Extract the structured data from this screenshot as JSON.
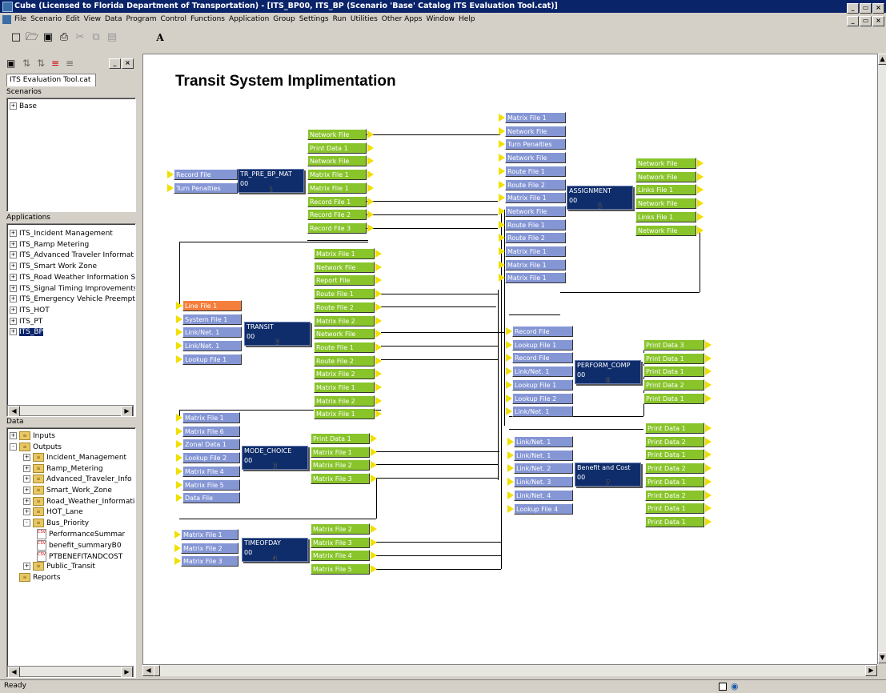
{
  "window": {
    "title": "Cube (Licensed to Florida Department of Transportation) - [ITS_BP00, ITS_BP (Scenario 'Base' Catalog ITS Evaluation Tool.cat)]"
  },
  "menu": [
    "File",
    "Scenario",
    "Edit",
    "View",
    "Data",
    "Program",
    "Control",
    "Functions",
    "Application",
    "Group",
    "Settings",
    "Run",
    "Utilities",
    "Other Apps",
    "Window",
    "Help"
  ],
  "toolbar_text_tool": "A",
  "panel": {
    "tab": "ITS Evaluation Tool.cat",
    "scenarios_title": "Scenarios",
    "scenarios": [
      "Base"
    ],
    "applications_title": "Applications",
    "applications": [
      "ITS_Incident Management",
      "ITS_Ramp Metering",
      "ITS_Advanced Traveler Informat",
      "ITS_Smart Work Zone",
      "ITS_Road Weather Information S",
      "ITS_Signal Timing Improvements",
      "ITS_Emergency Vehicle Preempt",
      "ITS_HOT",
      "ITS_PT",
      "ITS_BP"
    ],
    "data_title": "Data",
    "data": [
      {
        "label": "Inputs",
        "level": 0,
        "pm": "+",
        "kind": "folder"
      },
      {
        "label": "Outputs",
        "level": 0,
        "pm": "-",
        "kind": "folder"
      },
      {
        "label": "Incident_Management",
        "level": 1,
        "pm": "+",
        "kind": "folder"
      },
      {
        "label": "Ramp_Metering",
        "level": 1,
        "pm": "+",
        "kind": "folder"
      },
      {
        "label": "Advanced_Traveler_Info",
        "level": 1,
        "pm": "+",
        "kind": "folder"
      },
      {
        "label": "Smart_Work_Zone",
        "level": 1,
        "pm": "+",
        "kind": "folder"
      },
      {
        "label": "Road_Weather_Informati",
        "level": 1,
        "pm": "+",
        "kind": "folder"
      },
      {
        "label": "HOT_Lane",
        "level": 1,
        "pm": "+",
        "kind": "folder"
      },
      {
        "label": "Bus_Priority",
        "level": 1,
        "pm": "-",
        "kind": "folder"
      },
      {
        "label": "PerformanceSummar",
        "level": 2,
        "pm": "",
        "kind": "file"
      },
      {
        "label": "benefit_summaryB0",
        "level": 2,
        "pm": "",
        "kind": "file"
      },
      {
        "label": "PTBENEFITANDCOST",
        "level": 2,
        "pm": "",
        "kind": "file"
      },
      {
        "label": "Public_Transit",
        "level": 1,
        "pm": "+",
        "kind": "folder"
      },
      {
        "label": "Reports",
        "level": 0,
        "pm": "",
        "kind": "folder"
      }
    ]
  },
  "canvas": {
    "title": "Transit System Implimentation",
    "programs": [
      {
        "name": "TR_PRE_BP_MAT",
        "code": "00",
        "num": "1"
      },
      {
        "name": "TRANSIT",
        "code": "00",
        "num": "2"
      },
      {
        "name": "MODE_CHOICE",
        "code": "00",
        "num": "3"
      },
      {
        "name": "TIMEOFDAY",
        "code": "00",
        "num": "4"
      },
      {
        "name": "ASSIGNMENT",
        "code": "00",
        "num": "5"
      },
      {
        "name": "PERFORM_COMP",
        "code": "00",
        "num": "6"
      },
      {
        "name": "Benefit and Cost",
        "code": "00",
        "num": "7"
      }
    ],
    "p1_in": [
      "Record File",
      "Turn Penalties"
    ],
    "p1_out": [
      "Network File",
      "Print Data 1",
      "Network File",
      "Matrix File 1",
      "Matrix File 1",
      "Record File 1",
      "Record File 2",
      "Record File 3"
    ],
    "p2_in": [
      "Line File 1",
      "System File 1",
      "Link/Net. 1",
      "Link/Net. 1",
      "Lookup File 1"
    ],
    "p2_out": [
      "Matrix File 1",
      "Network File",
      "Report File",
      "Route File 1",
      "Route File 2",
      "Matrix File 2",
      "Network File",
      "Route File 1",
      "Route File 2",
      "Matrix File 2",
      "Matrix File 1",
      "Matrix File 2",
      "Matrix File 1"
    ],
    "p3_in": [
      "Matrix File 1",
      "Matrix File 6",
      "Zonal Data 1",
      "Lookup File 2",
      "Matrix File 4",
      "Matrix File 5",
      "Data File"
    ],
    "p3_out": [
      "Print Data 1",
      "Matrix File 1",
      "Matrix File 2",
      "Matrix File 3"
    ],
    "p4_in": [
      "Matrix File 1",
      "Matrix File 2",
      "Matrix File 3"
    ],
    "p4_out": [
      "Matrix File 2",
      "Matrix File 3",
      "Matrix File 4",
      "Matrix File 5"
    ],
    "p5_in": [
      "Matrix File 1",
      "Network File",
      "Turn Penalties",
      "Network File",
      "Route File 1",
      "Route File 2",
      "Matrix File 1",
      "Network File",
      "Route File 1",
      "Route File 2",
      "Matrix File 1",
      "Matrix File 1",
      "Matrix File 1"
    ],
    "p5_out": [
      "Network File",
      "Network File",
      "Links File 1",
      "Network File",
      "Links File 1",
      "Network File"
    ],
    "p6_in": [
      "Record File",
      "Lookup File 1",
      "Record File",
      "Link/Net. 1",
      "Lookup File 1",
      "Lookup File 2",
      "Link/Net. 1"
    ],
    "p6_out": [
      "Print Data 3",
      "Print Data 1",
      "Print Data 1",
      "Print Data 2",
      "Print Data 1"
    ],
    "p7_in": [
      "Link/Net. 1",
      "Link/Net. 1",
      "Link/Net. 2",
      "Link/Net. 3",
      "Link/Net. 4",
      "Lookup File 4"
    ],
    "p7_out": [
      "Print Data 1",
      "Print Data 2",
      "Print Data 1",
      "Print Data 2",
      "Print Data 1",
      "Print Data 2",
      "Print Data 1",
      "Print Data 1"
    ]
  },
  "status": {
    "text": "Ready"
  }
}
